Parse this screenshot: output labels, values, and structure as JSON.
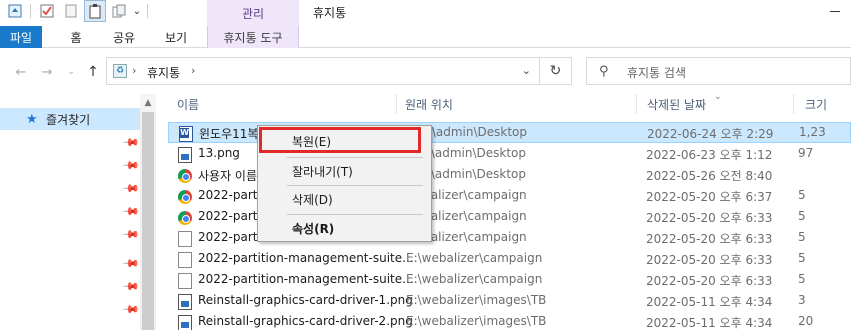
{
  "window": {
    "title": "휴지통",
    "contextual_tab_group": "관리"
  },
  "quick_access_icons": [
    "recycle-bin-icon",
    "properties-check-icon",
    "new-folder-icon",
    "paste-icon",
    "copy-icon",
    "customize-dropdown-icon"
  ],
  "ribbon": {
    "tabs": [
      "파일",
      "홈",
      "공유",
      "보기",
      "휴지통 도구"
    ]
  },
  "address": {
    "path": "휴지통",
    "separator": "›",
    "dropdown": "⌄",
    "refresh": "↻"
  },
  "search": {
    "placeholder": "휴지통 검색"
  },
  "navpane": {
    "quick_access_label": "즐겨찾기",
    "pinned_count": 7
  },
  "columns": {
    "name": "이름",
    "location": "원래 위치",
    "deleted": "삭제된 날짜",
    "size": "크기"
  },
  "rows": [
    {
      "name": "윈도우11복",
      "loc": "sers\\admin\\Desktop",
      "date": "2022-06-24 오후 2:29",
      "size": "1,23",
      "icon": "word-doc-icon",
      "selected": true
    },
    {
      "name": "13.png",
      "loc": "sers\\admin\\Desktop",
      "date": "2022-06-23 오후 1:12",
      "size": "97",
      "icon": "png-file-icon"
    },
    {
      "name": "사용자 이름",
      "loc": "sers\\admin\\Desktop",
      "date": "2022-05-26 오전 8:40",
      "size": "",
      "icon": "chrome-icon"
    },
    {
      "name": "2022-partiti",
      "loc": "webalizer\\campaign",
      "date": "2022-05-20 오후 6:37",
      "size": "5",
      "icon": "chrome-icon"
    },
    {
      "name": "2022-partiti",
      "loc": "webalizer\\campaign",
      "date": "2022-05-20 오후 6:33",
      "size": "5",
      "icon": "chrome-icon"
    },
    {
      "name": "2022-partiti",
      "loc": "webalizer\\campaign",
      "date": "2022-05-20 오후 6:33",
      "size": "5",
      "icon": "document-icon"
    },
    {
      "name": "2022-partition-management-suite....",
      "loc": "E:\\webalizer\\campaign",
      "date": "2022-05-20 오후 6:33",
      "size": "5",
      "icon": "document-icon"
    },
    {
      "name": "2022-partition-management-suite....",
      "loc": "E:\\webalizer\\campaign",
      "date": "2022-05-20 오후 6:33",
      "size": "5",
      "icon": "document-icon"
    },
    {
      "name": "Reinstall-graphics-card-driver-1.png",
      "loc": "E:\\webalizer\\images\\TB",
      "date": "2022-05-11 오후 4:34",
      "size": "3",
      "icon": "png-file-icon"
    },
    {
      "name": "Reinstall-graphics-card-driver-2.png",
      "loc": "E:\\webalizer\\images\\TB",
      "date": "2022-05-11 오후 4:34",
      "size": "20",
      "icon": "png-file-icon"
    }
  ],
  "context_menu": {
    "items": [
      "복원(E)",
      "잘라내기(T)",
      "삭제(D)",
      "속성(R)"
    ],
    "highlighted": "복원(E)"
  },
  "colors": {
    "file_tab": "#1979ca",
    "selection": "#cce8ff",
    "contextual_tab": "#f0e6fa",
    "highlight_box": "#e02929"
  }
}
